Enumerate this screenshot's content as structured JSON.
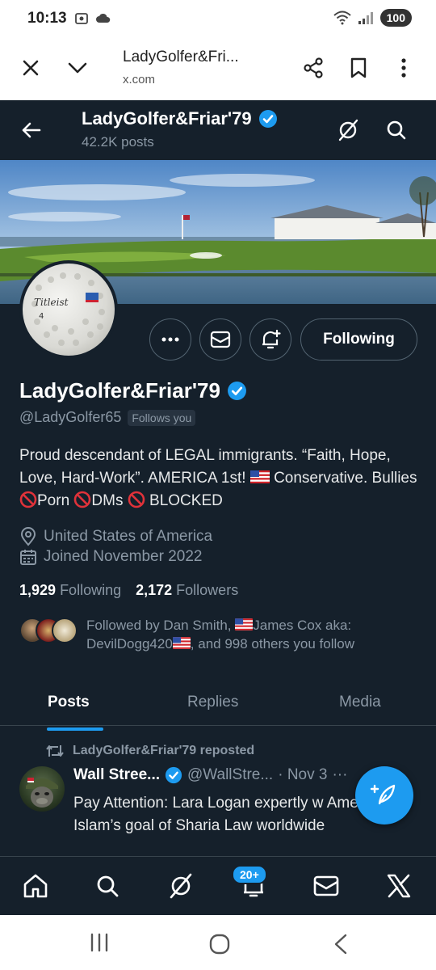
{
  "status": {
    "time": "10:13",
    "battery": "100"
  },
  "browser": {
    "page_title": "LadyGolfer&Fri...",
    "host": "x.com"
  },
  "profile": {
    "header_name": "LadyGolfer&Friar'79",
    "post_count": "42.2K posts",
    "name": "LadyGolfer&Friar'79",
    "handle": "@LadyGolfer65",
    "follows_you": "Follows you",
    "following_button": "Following",
    "bio_line_1": "Proud descendant of LEGAL immigrants. “Faith, Hope, Love, Hard-Work”. AMERICA 1st! ",
    "bio_conservative": "Conservative. Bullies ",
    "bio_porn": "Porn ",
    "bio_dms": "DMs ",
    "bio_blocked": " BLOCKED",
    "location": "United States of America",
    "joined": "Joined November 2022",
    "following_count": "1,929",
    "following_label": "Following",
    "followers_count": "2,172",
    "followers_label": "Followers",
    "followed_by_1": "Followed by Dan Smith, ",
    "followed_by_2": "James Cox aka: DevilDogg420",
    "followed_by_3": ", and 998 others you follow"
  },
  "tabs": [
    "Posts",
    "Replies",
    "Media"
  ],
  "tweet": {
    "repost_label": "LadyGolfer&Friar'79 reposted",
    "author_name": "Wall Stree...",
    "author_handle": "@WallStre...",
    "date": "· Nov 3",
    "more": "···",
    "text": "Pay Attention: Lara Logan expertly w America of Islam’s goal of Sharia Law worldwide"
  },
  "bottom_nav": {
    "notifications_badge": "20+"
  },
  "colors": {
    "background": "#15202b",
    "accent": "#1d9bf0",
    "muted": "#8b98a5",
    "verified": "#1d9bf0"
  }
}
